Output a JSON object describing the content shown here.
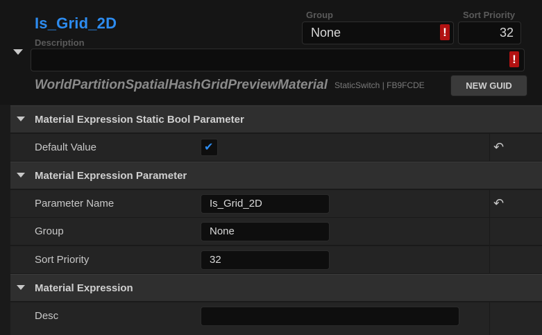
{
  "header": {
    "parameter_name": "Is_Grid_2D",
    "description_label": "Description",
    "description_value": "",
    "group_label": "Group",
    "group_value": "None",
    "sort_priority_label": "Sort Priority",
    "sort_priority_value": "32",
    "error_mark": "!",
    "material_name": "WorldPartitionSpatialHashGridPreviewMaterial",
    "static_switch_text": "StaticSwitch | FB9FCDE",
    "new_guid_label": "NEW GUID"
  },
  "sections": [
    {
      "title": "Material Expression Static Bool Parameter",
      "rows": [
        {
          "name": "Default Value",
          "type": "checkbox",
          "checked": true,
          "check_glyph": "✔",
          "reset_glyph": "↶"
        }
      ]
    },
    {
      "title": "Material Expression Parameter",
      "rows": [
        {
          "name": "Parameter Name",
          "type": "text",
          "value": "Is_Grid_2D",
          "reset_glyph": "↶"
        },
        {
          "name": "Group",
          "type": "text",
          "value": "None"
        },
        {
          "name": "Sort Priority",
          "type": "text",
          "value": "32"
        }
      ]
    },
    {
      "title": "Material Expression",
      "rows": [
        {
          "name": "Desc",
          "type": "text",
          "value": ""
        }
      ]
    }
  ],
  "colors": {
    "accent": "#2d8cf0",
    "error": "#b11212",
    "background": "#1a1a1a"
  }
}
